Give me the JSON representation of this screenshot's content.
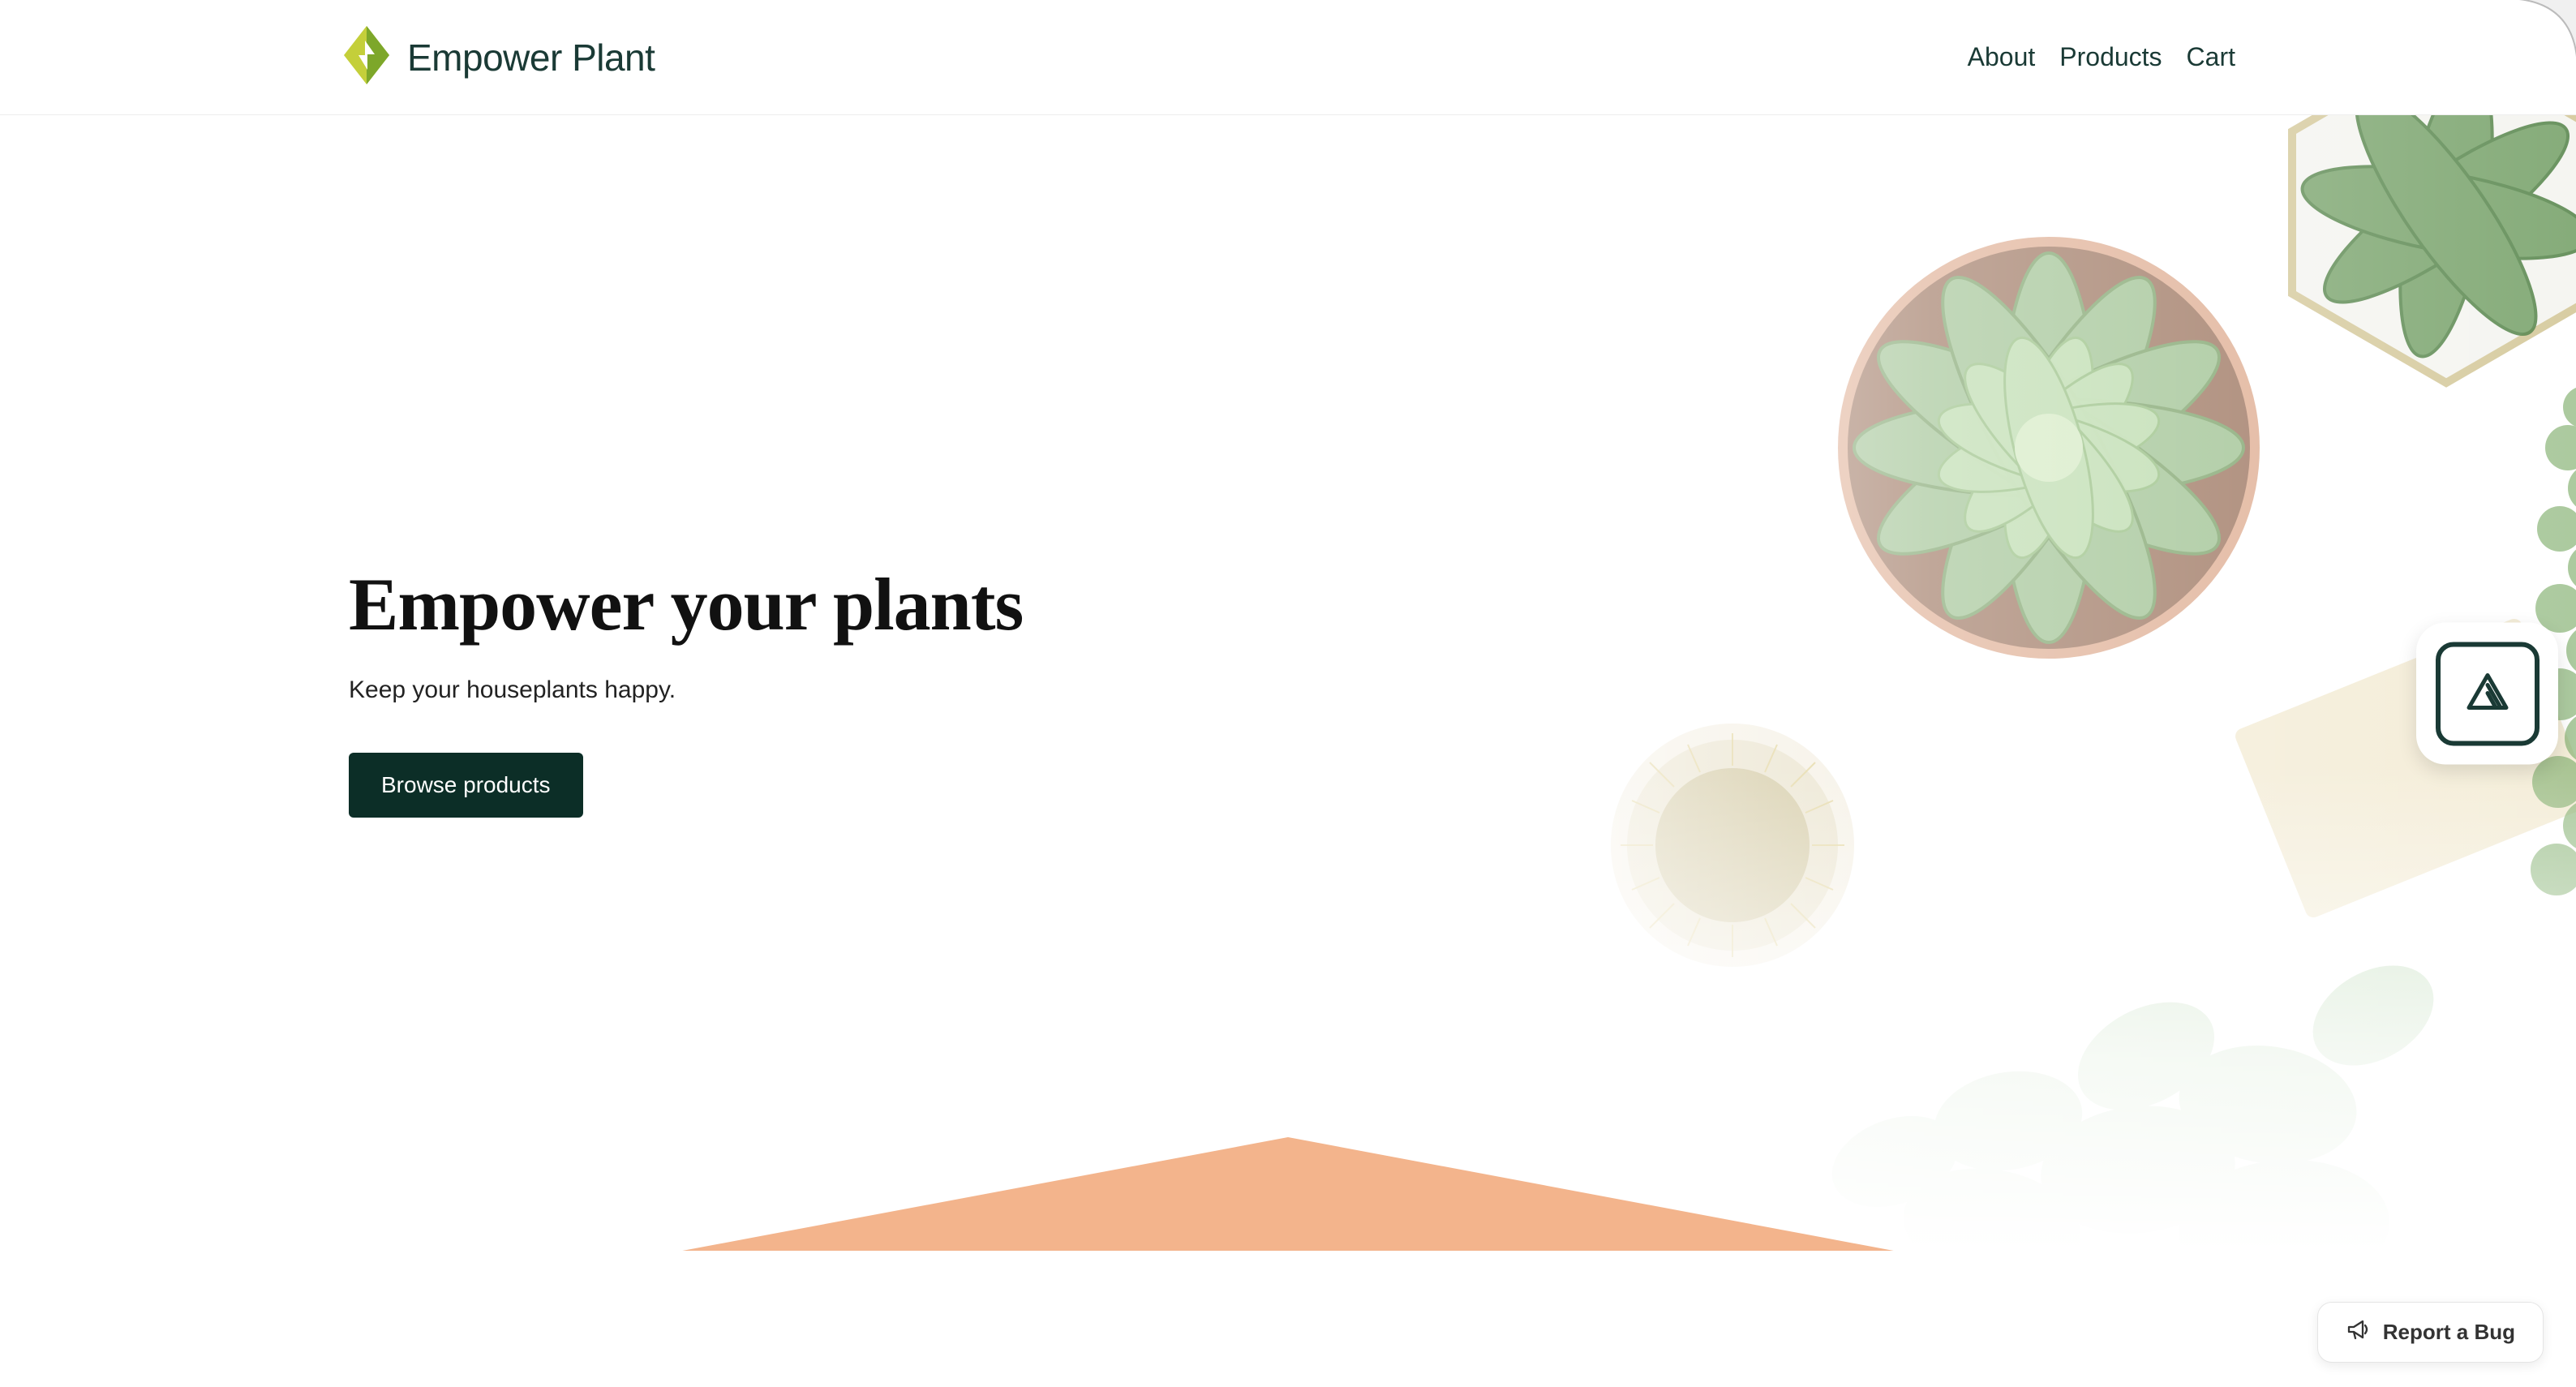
{
  "header": {
    "brand_name": "Empower Plant",
    "nav": {
      "about": "About",
      "products": "Products",
      "cart": "Cart"
    }
  },
  "hero": {
    "title": "Empower your plants",
    "subtitle": "Keep your houseplants happy.",
    "cta_label": "Browse products"
  },
  "widgets": {
    "report_bug_label": "Report a Bug"
  },
  "colors": {
    "brand_dark": "#0c2e27",
    "brand_text": "#1a3a35",
    "logo_yellow": "#c4cf3a",
    "logo_green": "#7da72a",
    "accent_peach": "#f3b48c"
  }
}
